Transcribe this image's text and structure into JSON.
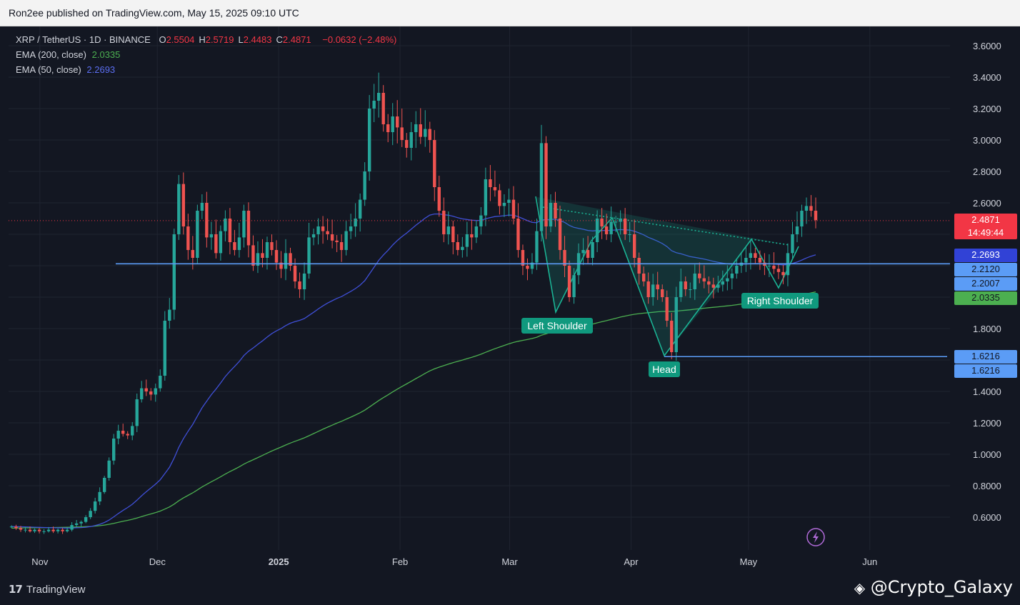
{
  "header": {
    "published": "Ron2ee published on TradingView.com, May 15, 2025 09:10 UTC"
  },
  "legend": {
    "symbol": "XRP / TetherUS · 1D · BINANCE",
    "ohlc": [
      {
        "k": "O",
        "v": "2.5504"
      },
      {
        "k": "H",
        "v": "2.5719"
      },
      {
        "k": "L",
        "v": "2.4483"
      },
      {
        "k": "C",
        "v": "2.4871"
      }
    ],
    "change": "−0.0632 (−2.48%)",
    "ema200_label": "EMA (200, close)",
    "ema200_value": "2.0335",
    "ema50_label": "EMA (50, close)",
    "ema50_value": "2.2693"
  },
  "colors": {
    "up": "#26a69a",
    "down": "#ef5350",
    "ema200": "#4caf50",
    "ema50": "#3f4fd6",
    "neckline": "#5b9cf6",
    "pattern": "#1ab394",
    "background": "#131722"
  },
  "price_tags": [
    {
      "text": "2.4871",
      "sub": "14:49:44",
      "bg": "#f23645",
      "fg": "#ffffff",
      "price": 2.4871
    },
    {
      "text": "2.2693",
      "bg": "#3142d6",
      "fg": "#ffffff",
      "price": 2.2693
    },
    {
      "text": "2.2120",
      "bg": "#5b9cf6",
      "fg": "#131722",
      "price": 2.212
    },
    {
      "text": "2.2007",
      "bg": "#5b9cf6",
      "fg": "#131722",
      "price": 2.2007
    },
    {
      "text": "2.0335",
      "bg": "#4caf50",
      "fg": "#131722",
      "price": 2.0335
    },
    {
      "text": "1.6216",
      "bg": "#5b9cf6",
      "fg": "#131722",
      "price": 1.6216
    },
    {
      "text": "1.6216",
      "bg": "#5b9cf6",
      "fg": "#131722",
      "price": 1.6216
    }
  ],
  "annotations": {
    "left_shoulder": "Left Shoulder",
    "head": "Head",
    "right_shoulder": "Right Shoulder"
  },
  "footer": {
    "brand": "TradingView",
    "brand_mark": "17",
    "watermark": "@Crypto_Galaxy"
  },
  "chart_data": {
    "type": "candlestick",
    "ylim": [
      0.45,
      3.72
    ],
    "yticks": [
      "0.6000",
      "0.8000",
      "1.0000",
      "1.2000",
      "1.4000",
      "1.6000",
      "1.8000",
      "2.0000",
      "2.2000",
      "2.4000",
      "2.6000",
      "2.8000",
      "3.0000",
      "3.2000",
      "3.4000",
      "3.6000"
    ],
    "xticks": [
      {
        "label": "Nov",
        "date": "2024-11-01",
        "bold": false
      },
      {
        "label": "Dec",
        "date": "2024-12-01",
        "bold": false
      },
      {
        "label": "2025",
        "date": "2025-01-01",
        "bold": true
      },
      {
        "label": "Feb",
        "date": "2025-02-01",
        "bold": false
      },
      {
        "label": "Mar",
        "date": "2025-03-01",
        "bold": false
      },
      {
        "label": "Apr",
        "date": "2025-04-01",
        "bold": false
      },
      {
        "label": "May",
        "date": "2025-05-01",
        "bold": false
      },
      {
        "label": "Jun",
        "date": "2025-06-01",
        "bold": false
      }
    ],
    "xrange": [
      "2024-10-24",
      "2025-06-16"
    ],
    "candles_approx_close": [
      0.54,
      0.53,
      0.52,
      0.52,
      0.51,
      0.52,
      0.51,
      0.51,
      0.52,
      0.51,
      0.52,
      0.51,
      0.52,
      0.55,
      0.56,
      0.57,
      0.6,
      0.64,
      0.7,
      0.76,
      0.85,
      0.96,
      1.1,
      1.15,
      1.13,
      1.12,
      1.18,
      1.35,
      1.42,
      1.4,
      1.38,
      1.42,
      1.5,
      1.85,
      1.92,
      2.4,
      2.72,
      2.45,
      2.3,
      2.25,
      2.55,
      2.6,
      2.38,
      2.4,
      2.28,
      2.42,
      2.5,
      2.35,
      2.3,
      2.38,
      2.55,
      2.33,
      2.2,
      2.28,
      2.25,
      2.35,
      2.3,
      2.22,
      2.18,
      2.28,
      2.2,
      2.1,
      2.05,
      2.15,
      2.38,
      2.4,
      2.45,
      2.42,
      2.4,
      2.36,
      2.35,
      2.3,
      2.42,
      2.45,
      2.5,
      2.62,
      2.8,
      3.2,
      3.25,
      3.3,
      3.1,
      3.05,
      3.15,
      3.08,
      3.0,
      2.95,
      3.05,
      3.1,
      3.02,
      3.07,
      3.0,
      2.7,
      2.55,
      2.4,
      2.45,
      2.35,
      2.3,
      2.32,
      2.4,
      2.38,
      2.45,
      2.52,
      2.75,
      2.7,
      2.68,
      2.58,
      2.6,
      2.62,
      2.5,
      2.3,
      2.2,
      2.18,
      2.22,
      2.42,
      2.98,
      2.45,
      2.6,
      2.5,
      2.3,
      2.2,
      2.0,
      2.14,
      2.28,
      2.3,
      2.25,
      2.35,
      2.5,
      2.45,
      2.4,
      2.48,
      2.48,
      2.5,
      2.4,
      2.4,
      2.25,
      2.15,
      2.1,
      2.0,
      2.08,
      2.05,
      2.0,
      1.85,
      1.65,
      2.0,
      2.1,
      2.05,
      2.05,
      2.15,
      2.12,
      2.1,
      2.08,
      2.06,
      2.08,
      2.1,
      2.12,
      2.15,
      2.2,
      2.22,
      2.25,
      2.28,
      2.25,
      2.22,
      2.2,
      2.2,
      2.18,
      2.16,
      2.14,
      2.28,
      2.4,
      2.45,
      2.55,
      2.58,
      2.55,
      2.49
    ],
    "series": [
      {
        "name": "EMA (200, close)",
        "last": 2.0335
      },
      {
        "name": "EMA (50, close)",
        "last": 2.2693
      }
    ],
    "levels": [
      {
        "price": 2.212,
        "note": "neckline"
      },
      {
        "price": 1.6216,
        "note": "head low"
      }
    ]
  }
}
